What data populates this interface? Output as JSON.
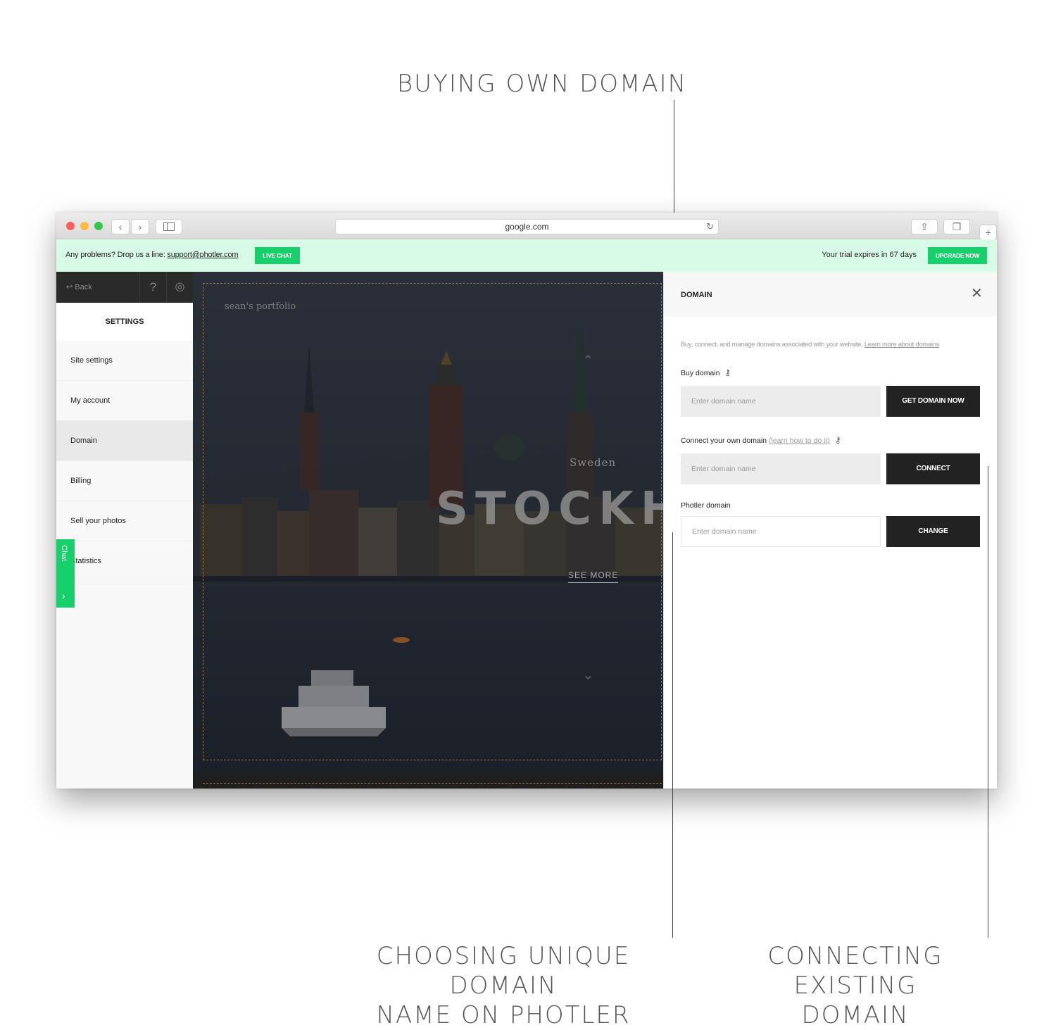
{
  "callouts": {
    "top": "BUYING OWN DOMAIN",
    "bottom_left_line1": "CHOOSING UNIQUE DOMAIN",
    "bottom_left_line2": "NAME ON PHOTLER",
    "bottom_right_line1": "CONNECTING EXISTING",
    "bottom_right_line2": "DOMAIN"
  },
  "browser": {
    "url": "google.com"
  },
  "banner": {
    "text": "Any problems? Drop us a line:",
    "email": "support@photler.com",
    "live_chat": "LIVE CHAT",
    "trial": "Your trial expires in 67 days",
    "upgrade": "UPGRADE NOW",
    "accent_color": "#17cf6b"
  },
  "sidebar": {
    "back": "Back",
    "help": "?",
    "heading": "SETTINGS",
    "items": [
      {
        "label": "Site settings"
      },
      {
        "label": "My account"
      },
      {
        "label": "Domain",
        "active": true
      },
      {
        "label": "Billing"
      },
      {
        "label": "Sell your photos"
      },
      {
        "label": "Statistics"
      }
    ]
  },
  "chat_tab": {
    "label": "Chat",
    "arrow": "›"
  },
  "preview": {
    "portfolio": "sean's portfolio",
    "country": "Sweden",
    "city": "STOCKHOLM",
    "see_more": "SEE MORE"
  },
  "panel": {
    "title": "DOMAIN",
    "description": "Buy, connect, and manage domains associated with your website.",
    "learn_more": "Learn more about domains",
    "buy": {
      "label": "Buy domain",
      "placeholder": "Enter domain name",
      "button": "GET DOMAIN NOW"
    },
    "connect": {
      "label": "Connect your own domain",
      "hint": "(learn how to do it)",
      "placeholder": "Enter domain name",
      "button": "CONNECT"
    },
    "photler": {
      "label": "Photler domain",
      "placeholder": "Enter domain name",
      "button": "CHANGE"
    }
  }
}
